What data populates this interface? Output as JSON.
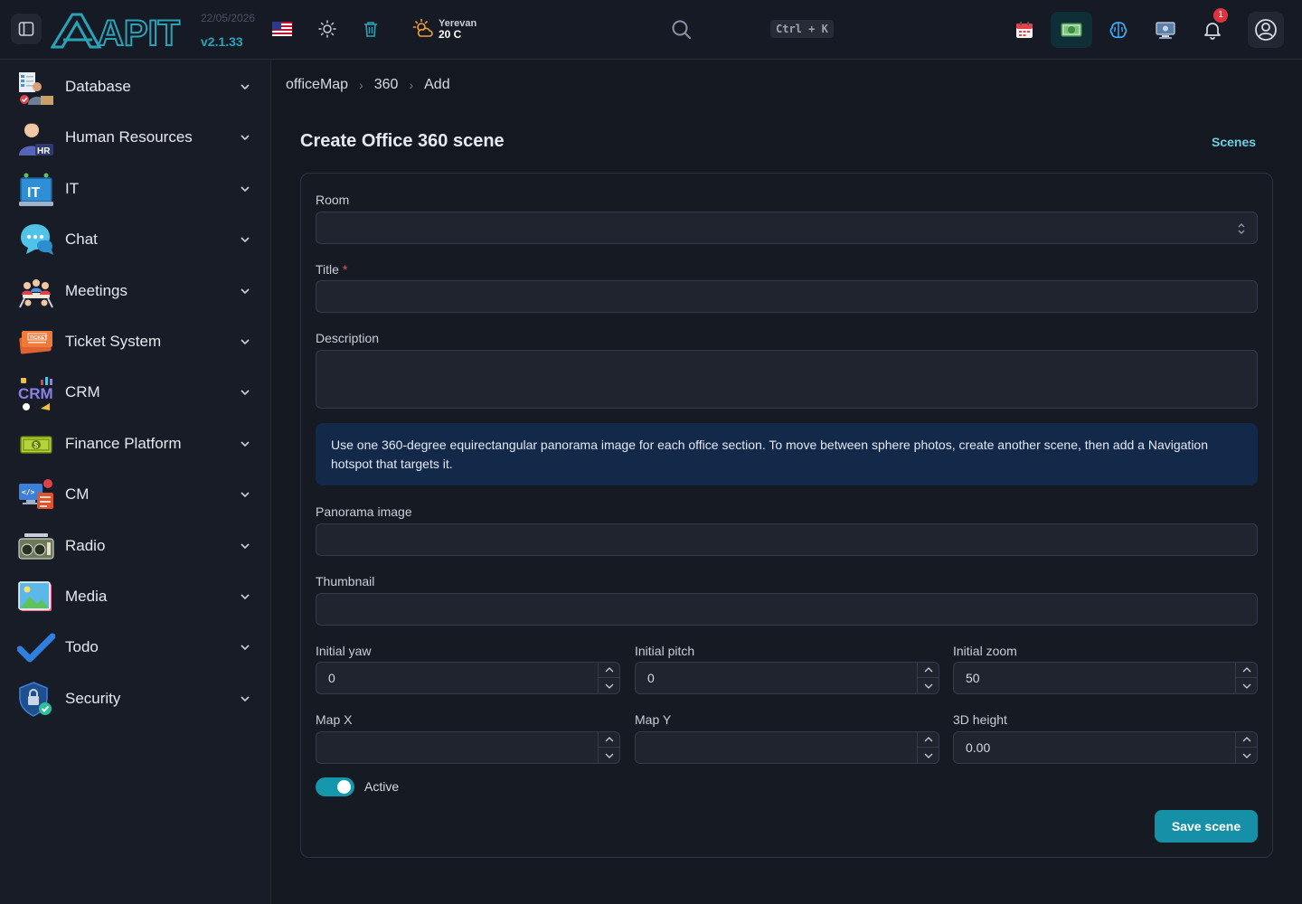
{
  "header": {
    "logo_text": "APIT",
    "date": "22/05/2026",
    "version": "v2.1.33",
    "weather_city": "Yerevan",
    "weather_temp": "20 C",
    "search_shortcut": "Ctrl + K",
    "notification_count": "1",
    "accent_color": "#1590a6"
  },
  "sidebar": {
    "items": [
      {
        "label": "Database",
        "icon": "database-icon"
      },
      {
        "label": "Human Resources",
        "icon": "hr-icon"
      },
      {
        "label": "IT",
        "icon": "it-laptop-icon"
      },
      {
        "label": "Chat",
        "icon": "chat-bubble-icon"
      },
      {
        "label": "Meetings",
        "icon": "meetings-icon"
      },
      {
        "label": "Ticket System",
        "icon": "ticket-icon"
      },
      {
        "label": "CRM",
        "icon": "crm-icon"
      },
      {
        "label": "Finance Platform",
        "icon": "money-icon"
      },
      {
        "label": "CM",
        "icon": "cm-icon"
      },
      {
        "label": "Radio",
        "icon": "radio-icon"
      },
      {
        "label": "Media",
        "icon": "picture-icon"
      },
      {
        "label": "Todo",
        "icon": "checkmark-icon"
      },
      {
        "label": "Security",
        "icon": "shield-lock-icon"
      }
    ]
  },
  "breadcrumb": [
    "officeMap",
    "360",
    "Add"
  ],
  "page": {
    "title": "Create Office 360 scene",
    "scenes_link": "Scenes"
  },
  "form": {
    "room": {
      "label": "Room",
      "value": ""
    },
    "title": {
      "label": "Title",
      "required_mark": "*",
      "value": ""
    },
    "description": {
      "label": "Description",
      "value": ""
    },
    "info": "Use one 360-degree equirectangular panorama image for each office section. To move between sphere photos, create another scene, then add a Navigation hotspot that targets it.",
    "panorama": {
      "label": "Panorama image",
      "value": ""
    },
    "thumbnail": {
      "label": "Thumbnail",
      "value": ""
    },
    "initial_yaw": {
      "label": "Initial yaw",
      "value": "0"
    },
    "initial_pitch": {
      "label": "Initial pitch",
      "value": "0"
    },
    "initial_zoom": {
      "label": "Initial zoom",
      "value": "50"
    },
    "map_x": {
      "label": "Map X",
      "value": ""
    },
    "map_y": {
      "label": "Map Y",
      "value": ""
    },
    "height_3d": {
      "label": "3D height",
      "value": "0.00"
    },
    "active": {
      "label": "Active",
      "checked": true
    },
    "save_label": "Save scene"
  }
}
